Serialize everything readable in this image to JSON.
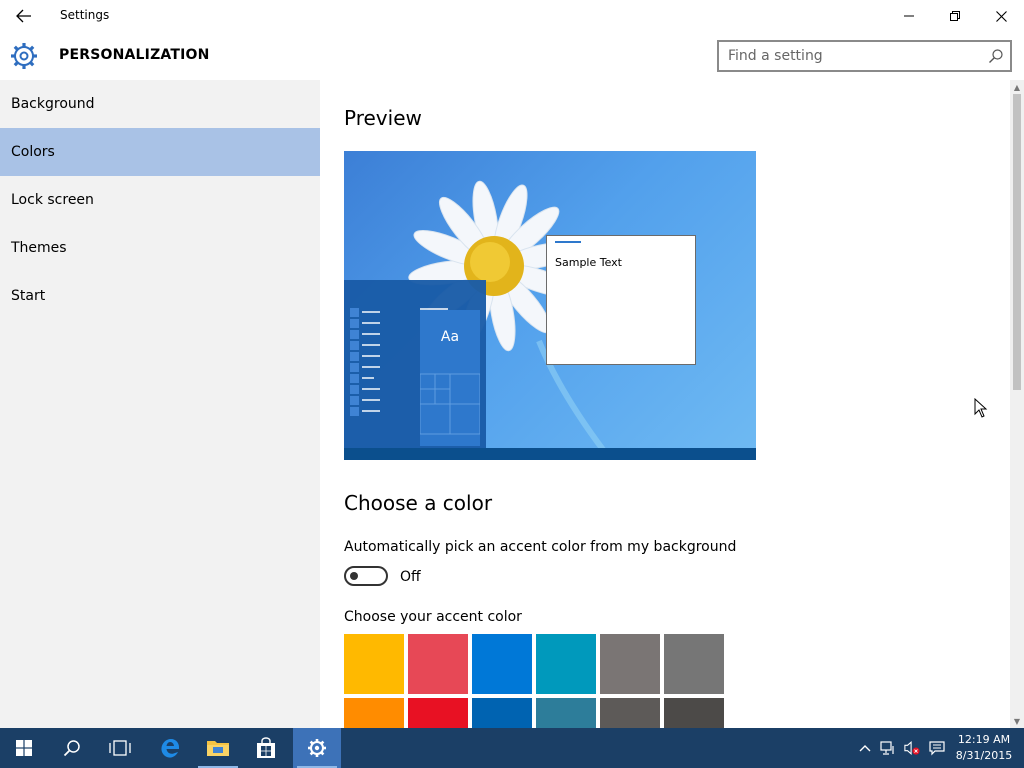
{
  "window": {
    "title": "Settings"
  },
  "header": {
    "section": "PERSONALIZATION",
    "search_placeholder": "Find a setting"
  },
  "sidebar": {
    "items": [
      {
        "label": "Background",
        "active": false
      },
      {
        "label": "Colors",
        "active": true
      },
      {
        "label": "Lock screen",
        "active": false
      },
      {
        "label": "Themes",
        "active": false
      },
      {
        "label": "Start",
        "active": false
      }
    ]
  },
  "main": {
    "preview_heading": "Preview",
    "preview_tile_text": "Aa",
    "preview_sample_text": "Sample Text",
    "choose_heading": "Choose a color",
    "auto_label": "Automatically pick an accent color from my background",
    "toggle_state": "Off",
    "accent_label": "Choose your accent color",
    "accent_colors": [
      "#ffb900",
      "#e74856",
      "#0078d7",
      "#0099bc",
      "#7a7574",
      "#767676",
      "#ff8c00",
      "#e81123",
      "#0063b1",
      "#2d7d9a",
      "#5d5a58",
      "#4c4a48"
    ]
  },
  "taskbar": {
    "time": "12:19 AM",
    "date": "8/31/2015"
  },
  "colors": {
    "selected_nav": "#a9c2e6",
    "sidebar_bg": "#f2f2f2",
    "taskbar_bg": "#1b3f66",
    "taskbar_active": "#3d72b8"
  }
}
